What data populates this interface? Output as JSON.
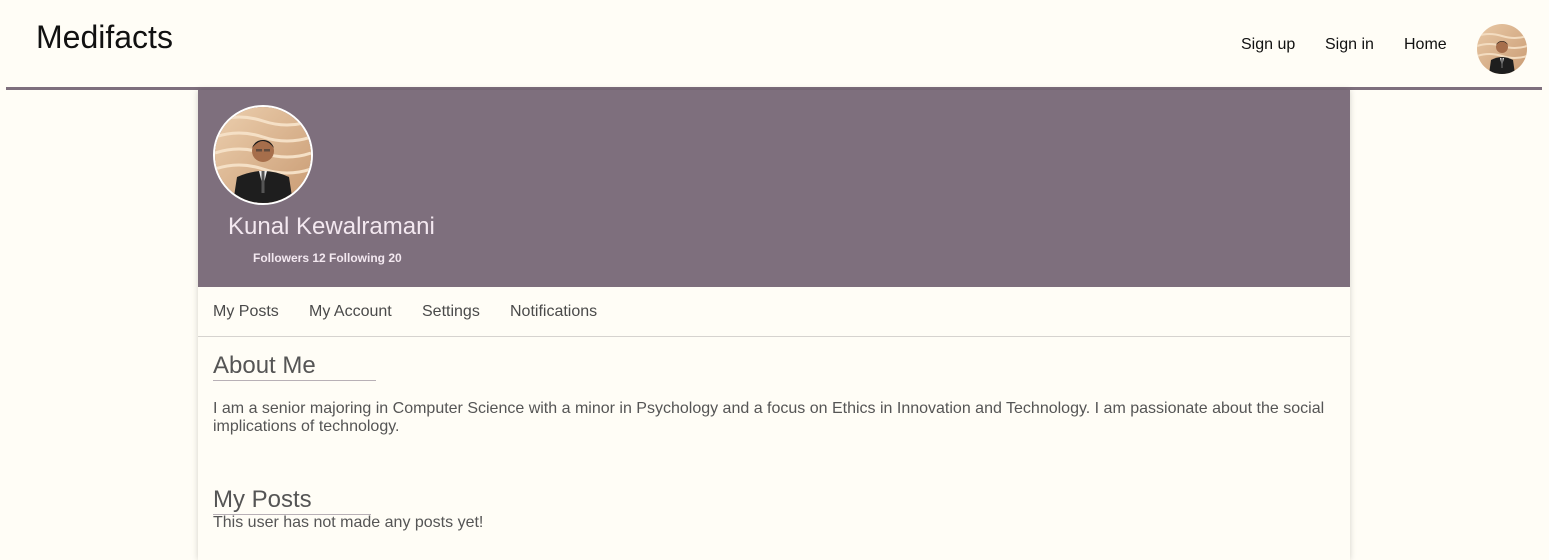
{
  "app": {
    "brand": "Medifacts"
  },
  "nav": {
    "sign_up": "Sign up",
    "sign_in": "Sign in",
    "home": "Home",
    "avatar_icon": "user-avatar-icon"
  },
  "profile": {
    "name": "Kunal Kewalramani",
    "stats": "Followers 12 Following 20",
    "avatar_icon": "profile-avatar-icon"
  },
  "tabs": [
    {
      "label": "My Posts"
    },
    {
      "label": "My Account"
    },
    {
      "label": "Settings"
    },
    {
      "label": "Notifications"
    }
  ],
  "about": {
    "heading": "About Me",
    "text": "I am a senior majoring in Computer Science with a minor in Psychology and a focus on Ethics in Innovation and Technology. I am passionate about the social implications of technology."
  },
  "posts": {
    "heading": "My Posts",
    "empty_message": "This user has not made any posts yet!"
  },
  "colors": {
    "page_bg": "#fffdf6",
    "accent": "#7e6f7d",
    "hero_text": "#f3e8f0",
    "body_text": "#555555"
  }
}
